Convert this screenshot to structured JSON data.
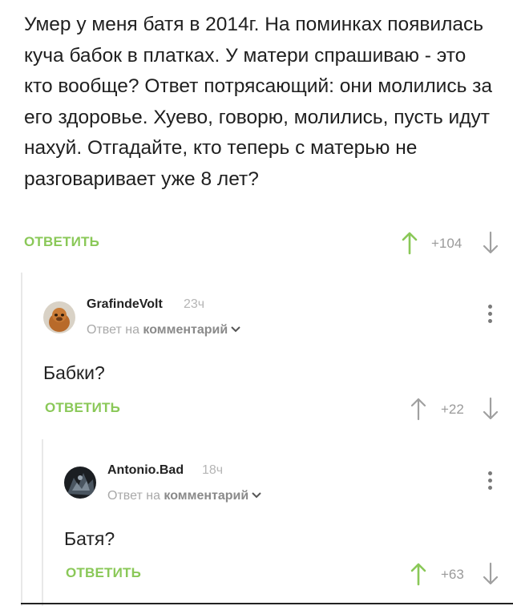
{
  "post": {
    "text": "Умер у меня батя в 2014г. На поминках появилась куча бабок в платках. У матери спрашиваю - это кто вообще? Ответ потрясающий: они молились за его здоровье. Хуево, говорю, молились, пусть идут нахуй. Отгадайте, кто теперь с матерью не разговаривает уже 8 лет?",
    "reply_label": "ОТВЕТИТЬ",
    "score": "+104"
  },
  "comments": [
    {
      "author": "GrafindeVolt",
      "time": "23ч",
      "reply_prefix": "Ответ на",
      "reply_target": "комментарий",
      "text": "Бабки?",
      "reply_label": "ОТВЕТИТЬ",
      "score": "+22"
    },
    {
      "author": "Antonio.Bad",
      "time": "18ч",
      "reply_prefix": "Ответ на",
      "reply_target": "комментарий",
      "text": "Батя?",
      "reply_label": "ОТВЕТИТЬ",
      "score": "+63"
    }
  ],
  "icons": {
    "upvote": "arrow-up-icon",
    "downvote": "arrow-down-icon",
    "menu": "more-vertical-icon",
    "chevron": "chevron-down-icon"
  },
  "colors": {
    "accent_green": "#8ac858",
    "muted_gray": "#9a9a9a",
    "text": "#222222"
  }
}
